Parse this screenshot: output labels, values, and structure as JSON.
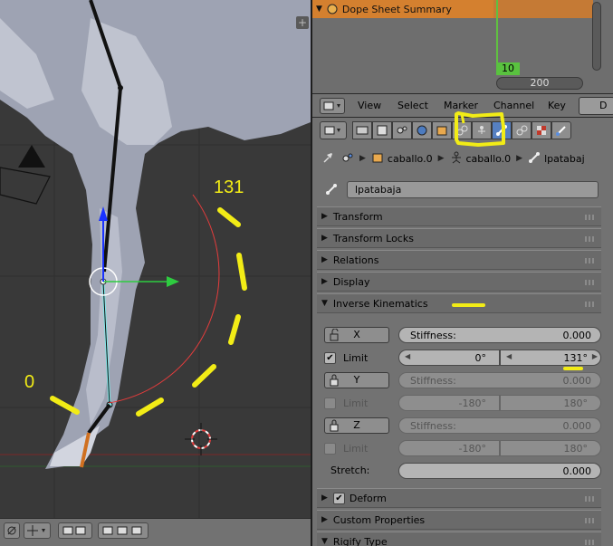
{
  "viewport": {
    "annotations": {
      "angle_label": "131",
      "zero_label": "0"
    },
    "colors": {
      "annotation_yellow": "#f2ec16",
      "ik_arc_red": "#e43c3c",
      "bone_cyan": "#7fe6e6",
      "axis_green": "#2ecc40",
      "axis_blue": "#1a32ff"
    }
  },
  "dopesheet": {
    "summary_label": "Dope Sheet Summary",
    "current_frame": "10",
    "scroll_value": "200"
  },
  "header": {
    "menu": [
      "View",
      "Select",
      "Marker",
      "Channel",
      "Key"
    ],
    "editor_type": "D"
  },
  "properties": {
    "breadcrumb": {
      "object": "caballo.0",
      "armature": "caballo.0",
      "bone": "lpatabaj"
    },
    "bone_name": "lpatabaja",
    "panels": {
      "transform": "Transform",
      "transform_locks": "Transform Locks",
      "relations": "Relations",
      "display": "Display",
      "inverse_kinematics": "Inverse Kinematics",
      "deform": "Deform",
      "custom_properties": "Custom Properties",
      "rigify_type": "Rigify Type"
    },
    "ik": {
      "x": {
        "lock_label": "X",
        "stiffness_label": "Stiffness:",
        "stiffness": "0.000",
        "limit_label": "Limit",
        "limit_checked": true,
        "min": "0°",
        "max": "131°"
      },
      "y": {
        "lock_label": "Y",
        "stiffness_label": "Stiffness:",
        "stiffness": "0.000",
        "limit_label": "Limit",
        "limit_checked": false,
        "min": "-180°",
        "max": "180°"
      },
      "z": {
        "lock_label": "Z",
        "stiffness_label": "Stiffness:",
        "stiffness": "0.000",
        "limit_label": "Limit",
        "limit_checked": false,
        "min": "-180°",
        "max": "180°"
      },
      "stretch_label": "Stretch:",
      "stretch": "0.000"
    },
    "colors": {
      "active_tab": "#5680c2",
      "highlight_yellow": "#f2ec16"
    }
  }
}
